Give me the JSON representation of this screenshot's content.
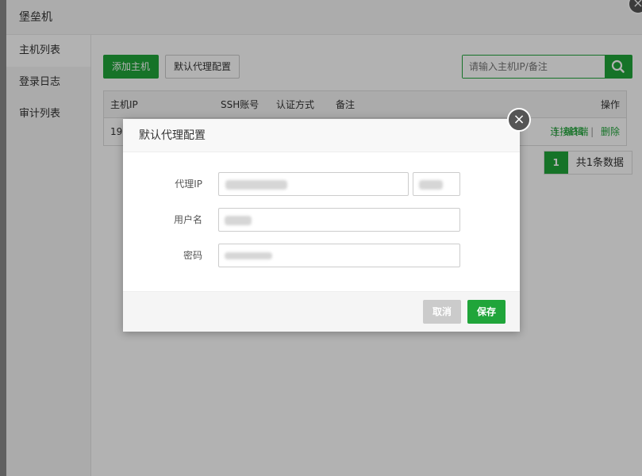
{
  "window": {
    "title": "堡垒机",
    "close_icon": "×"
  },
  "sidebar": {
    "items": [
      {
        "label": "主机列表",
        "active": true
      },
      {
        "label": "登录日志",
        "active": false
      },
      {
        "label": "审计列表",
        "active": false
      }
    ]
  },
  "toolbar": {
    "add_label": "添加主机",
    "proxy_label": "默认代理配置",
    "search_placeholder": "请输入主机IP/备注"
  },
  "table": {
    "headers": [
      "主机IP",
      "SSH账号",
      "认证方式",
      "备注",
      "操作"
    ],
    "rows": [
      {
        "ip": "19",
        "actions": [
          "连接终端",
          "编辑",
          "删除"
        ],
        "separator": "|"
      }
    ]
  },
  "pager": {
    "current": "1",
    "total_text": "共1条数据"
  },
  "dialog": {
    "title": "默认代理配置",
    "fields": {
      "proxy_ip_label": "代理IP",
      "username_label": "用户名",
      "password_label": "密码"
    },
    "cancel_label": "取消",
    "save_label": "保存"
  },
  "colors": {
    "accent": "#20a53a",
    "cancel": "#cbcbcb"
  }
}
